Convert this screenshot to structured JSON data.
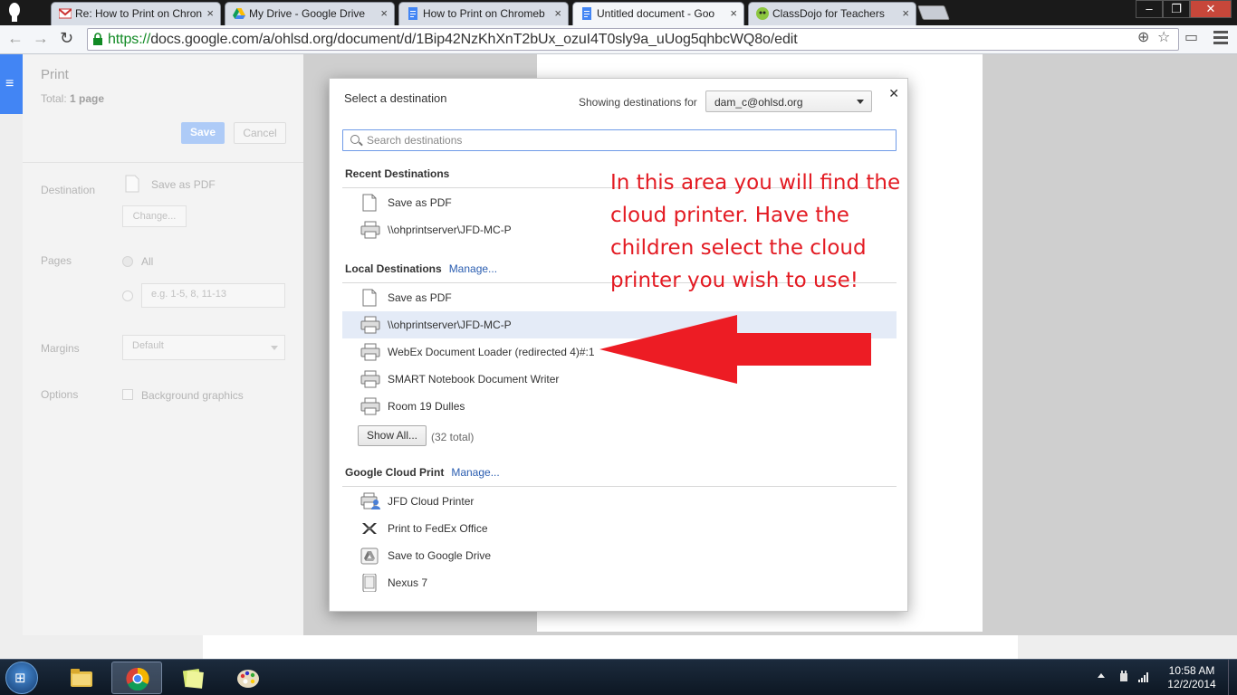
{
  "browser": {
    "tabs": [
      {
        "title": "Re: How to Print on Chron",
        "icon": "gmail-icon",
        "active": false
      },
      {
        "title": "My Drive - Google Drive",
        "icon": "drive-icon",
        "active": false
      },
      {
        "title": "How to Print on Chromeb",
        "icon": "docs-icon",
        "active": false
      },
      {
        "title": "Untitled document - Goo",
        "icon": "docs-icon",
        "active": true
      },
      {
        "title": "ClassDojo for Teachers",
        "icon": "classdojo-icon",
        "active": false
      }
    ],
    "url_scheme": "https://",
    "url_rest": "docs.google.com/a/ohlsd.org/document/d/1Bip42NzKhXnT2bUx_ozuI4T0sly9a_uUog5qhbcWQ8o/edit"
  },
  "print_panel": {
    "title": "Print",
    "total_label": "Total:",
    "total_value": "1 page",
    "save_label": "Save",
    "cancel_label": "Cancel",
    "destination_label": "Destination",
    "destination_value": "Save as PDF",
    "change_label": "Change...",
    "pages_label": "Pages",
    "pages_all": "All",
    "pages_placeholder": "e.g. 1-5, 8, 11-13",
    "margins_label": "Margins",
    "margins_value": "Default",
    "options_label": "Options",
    "options_value": "Background graphics"
  },
  "dialog": {
    "title": "Select a destination",
    "showing_label": "Showing destinations for",
    "account": "dam_c@ohlsd.org",
    "search_placeholder": "Search destinations",
    "recent": {
      "heading": "Recent Destinations",
      "items": [
        {
          "label": "Save as PDF",
          "icon": "pdf-file-icon"
        },
        {
          "label": "\\\\ohprintserver\\JFD-MC-P",
          "icon": "printer-icon"
        }
      ]
    },
    "local": {
      "heading": "Local Destinations",
      "manage": "Manage...",
      "items": [
        {
          "label": "Save as PDF",
          "icon": "pdf-file-icon",
          "selected": false
        },
        {
          "label": "\\\\ohprintserver\\JFD-MC-P",
          "icon": "printer-icon",
          "selected": true
        },
        {
          "label": "WebEx Document Loader (redirected 4)#:1",
          "icon": "printer-icon",
          "selected": false
        },
        {
          "label": "SMART Notebook Document Writer",
          "icon": "printer-icon",
          "selected": false
        },
        {
          "label": "Room 19 Dulles",
          "icon": "printer-icon",
          "selected": false
        }
      ],
      "show_all": "Show All...",
      "total": "(32 total)"
    },
    "cloud": {
      "heading": "Google Cloud Print",
      "manage": "Manage...",
      "items": [
        {
          "label": "JFD Cloud Printer",
          "icon": "cloud-printer-icon"
        },
        {
          "label": "Print to FedEx Office",
          "icon": "fedex-icon"
        },
        {
          "label": "Save to Google Drive",
          "icon": "google-drive-icon"
        },
        {
          "label": "Nexus 7",
          "icon": "tablet-icon"
        }
      ]
    }
  },
  "annotation": {
    "text": "In this area you will find the cloud printer. Have the children select the cloud printer you wish to use!",
    "color": "#e31b23"
  },
  "taskbar": {
    "time": "10:58 AM",
    "date": "12/2/2014"
  }
}
